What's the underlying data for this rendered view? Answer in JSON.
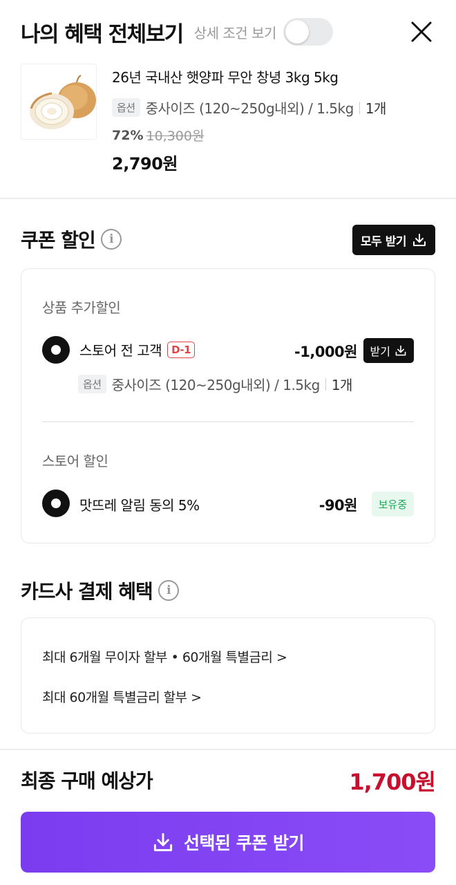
{
  "header": {
    "title": "나의 혜택 전체보기",
    "toggle_label": "상세 조건 보기",
    "toggle_on": false
  },
  "product": {
    "name": "26년 국내산 햇양파 무안 창녕 3kg 5kg",
    "option_tag": "옵션",
    "option_text": "중사이즈 (120~250g내외) / 1.5kg",
    "quantity": "1개",
    "discount_rate": "72%",
    "original_price": "10,300원",
    "price": "2,790원"
  },
  "coupon": {
    "title": "쿠폰 할인",
    "download_all_label": "모두 받기",
    "product_group": {
      "label": "상품 추가할인",
      "item": {
        "name": "스토어 전 고객",
        "dday": "D-1",
        "amount": "-1,000원",
        "button_label": "받기",
        "option_tag": "옵션",
        "option_text": "중사이즈 (120~250g내외) / 1.5kg",
        "quantity": "1개"
      }
    },
    "store_group": {
      "label": "스토어 할인",
      "item": {
        "name": "맛뜨레 알림 동의 5%",
        "amount": "-90원",
        "status": "보유중"
      }
    }
  },
  "card_benefit": {
    "title": "카드사 결제 혜택",
    "links": [
      "최대 6개월 무이자 할부 • 60개월 특별금리 >",
      "최대 60개월 특별금리 할부 >"
    ]
  },
  "total": {
    "label": "최종 구매 예상가",
    "price": "1,700원"
  },
  "cta": {
    "label": "선택된 쿠폰 받기"
  },
  "colors": {
    "accent": "#7b3cf0",
    "price_red": "#c8102e",
    "owned_green": "#1faa59",
    "dday_red": "#e04545"
  }
}
